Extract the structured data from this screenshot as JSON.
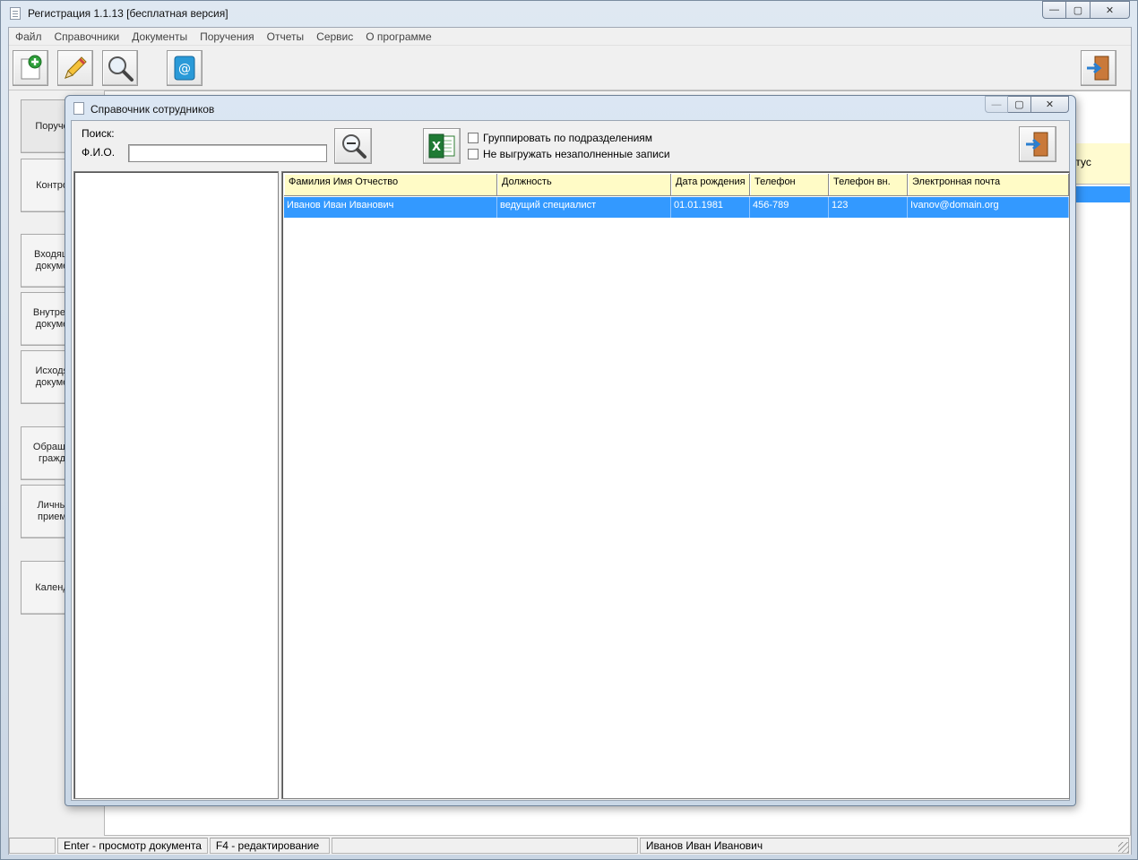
{
  "app": {
    "title": "Регистрация 1.1.13 [бесплатная версия]",
    "window_buttons": {
      "minimize": "—",
      "maximize": "▢",
      "close": "✕"
    }
  },
  "menu": [
    "Файл",
    "Справочники",
    "Документы",
    "Поручения",
    "Отчеты",
    "Сервис",
    "О программе"
  ],
  "toolbar": {
    "buttons": [
      "add-icon",
      "edit-icon",
      "search-icon",
      "address-book-icon"
    ],
    "exit_button": "exit-door-icon"
  },
  "nav": [
    "Поруче",
    "Контро",
    "Входящ\nдокуме",
    "Внутрен\nдокуме",
    "Исходя\nдокуме",
    "Обраще\nгражд",
    "Личны\nприем",
    "Календ"
  ],
  "main_grid": {
    "status_header": "атус"
  },
  "statusbar": {
    "hint_enter": "Enter - просмотр документа",
    "hint_f4": "F4 - редактирование",
    "user": "Иванов Иван Иванович"
  },
  "dialog": {
    "title": "Справочник сотрудников",
    "search_label": "Поиск:",
    "fio_label": "Ф.И.О.",
    "fio_value": "",
    "group_checkbox_label": "Группировать по подразделениям",
    "group_checked": false,
    "skip_empty_label": "Не выгружать незаполненные записи",
    "skip_empty_checked": false,
    "columns": [
      "Фамилия Имя Отчество",
      "Должность",
      "Дата рождения",
      "Телефон",
      "Телефон вн.",
      "Электронная почта"
    ],
    "rows": [
      [
        "Иванов Иван Иванович",
        "ведущий специалист",
        "01.01.1981",
        "456-789",
        "123",
        "Ivanov@domain.org"
      ]
    ],
    "selection_color": "#3399ff",
    "header_color": "#fffbc6"
  }
}
